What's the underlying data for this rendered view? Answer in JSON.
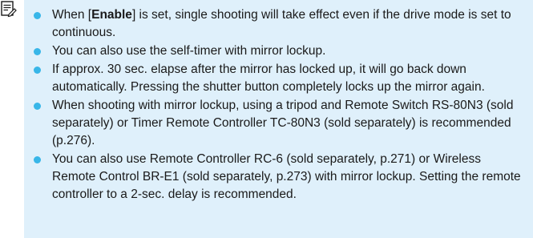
{
  "icon": "memo-icon",
  "colors": {
    "panel_background": "#dff0fb",
    "bullet": "#38b6e8",
    "text": "#1a1a1a"
  },
  "notes": [
    {
      "before": "When [",
      "emphasis": "Enable",
      "after": "] is set, single shooting will take effect even if the drive mode is set to continuous."
    },
    {
      "text": "You can also use the self-timer with mirror lockup."
    },
    {
      "text": "If approx. 30 sec. elapse after the mirror has locked up, it will go back down automatically. Pressing the shutter button completely locks up the mirror again."
    },
    {
      "text": "When shooting with mirror lockup, using a tripod and Remote Switch RS-80N3 (sold separately) or Timer Remote Controller TC-80N3 (sold separately) is recommended (p.276)."
    },
    {
      "text": "You can also use Remote Controller RC-6 (sold separately, p.271) or Wireless Remote Control BR-E1 (sold separately, p.273) with mirror lockup. Setting the remote controller to a 2-sec. delay is recommended."
    }
  ]
}
